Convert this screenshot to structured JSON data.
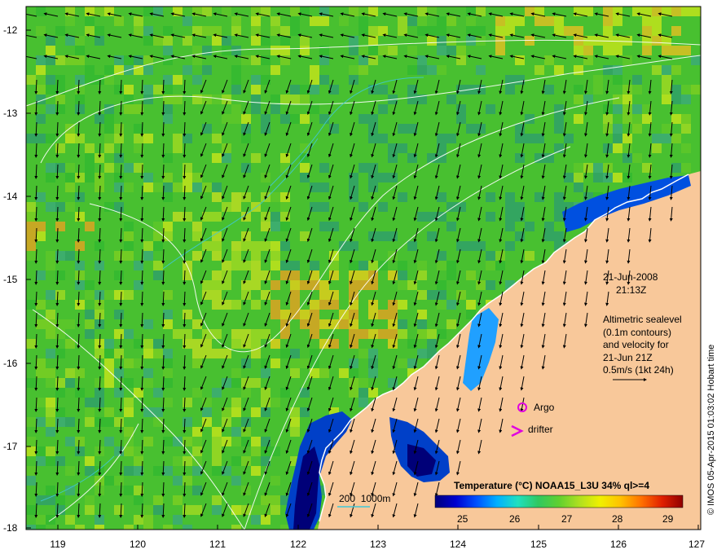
{
  "axes": {
    "y_ticks": [
      "-12",
      "-13",
      "-14",
      "-15",
      "-16",
      "-17",
      "-18"
    ],
    "x_ticks": [
      "119",
      "120",
      "121",
      "122",
      "123",
      "124",
      "125",
      "126",
      "127"
    ]
  },
  "annotation": {
    "date": "21-Jun-2008",
    "time": "21:13Z",
    "altimetry_lines": [
      "Altimetric sealevel",
      "(0.1m contours)",
      "and velocity for",
      "21-Jun 21Z"
    ],
    "velocity_scale": "0.5m/s (1kt 24h)"
  },
  "legend": {
    "argo": "Argo",
    "drifter": "drifter",
    "argo_color": "#e000e0",
    "drifter_color": "#e000e0",
    "bathymetry": "200  1000m",
    "bathymetry_color": "#40c8d8"
  },
  "colorbar": {
    "title": "Temperature (°C) NOAA15_L3U 34% ql>=4",
    "ticks": [
      "25",
      "26",
      "27",
      "28",
      "29"
    ],
    "colors": [
      "#00007a",
      "#0000d0",
      "#0050ff",
      "#00b0ff",
      "#20e0c0",
      "#30c860",
      "#60d030",
      "#b0e020",
      "#f0f000",
      "#ffc000",
      "#ff7000",
      "#e02000",
      "#900000"
    ]
  },
  "credit": "© IMOS 05-Apr-2015 01:03:02 Hobart time",
  "colors": {
    "land": "#f8c89a",
    "ocean_green": "#48c030",
    "ocean_teal": "#30a878",
    "ocean_yellow": "#c8e020",
    "ocean_orange": "#f0a020",
    "shelf_blue": "#0038c0",
    "deep_navy": "#000070"
  }
}
